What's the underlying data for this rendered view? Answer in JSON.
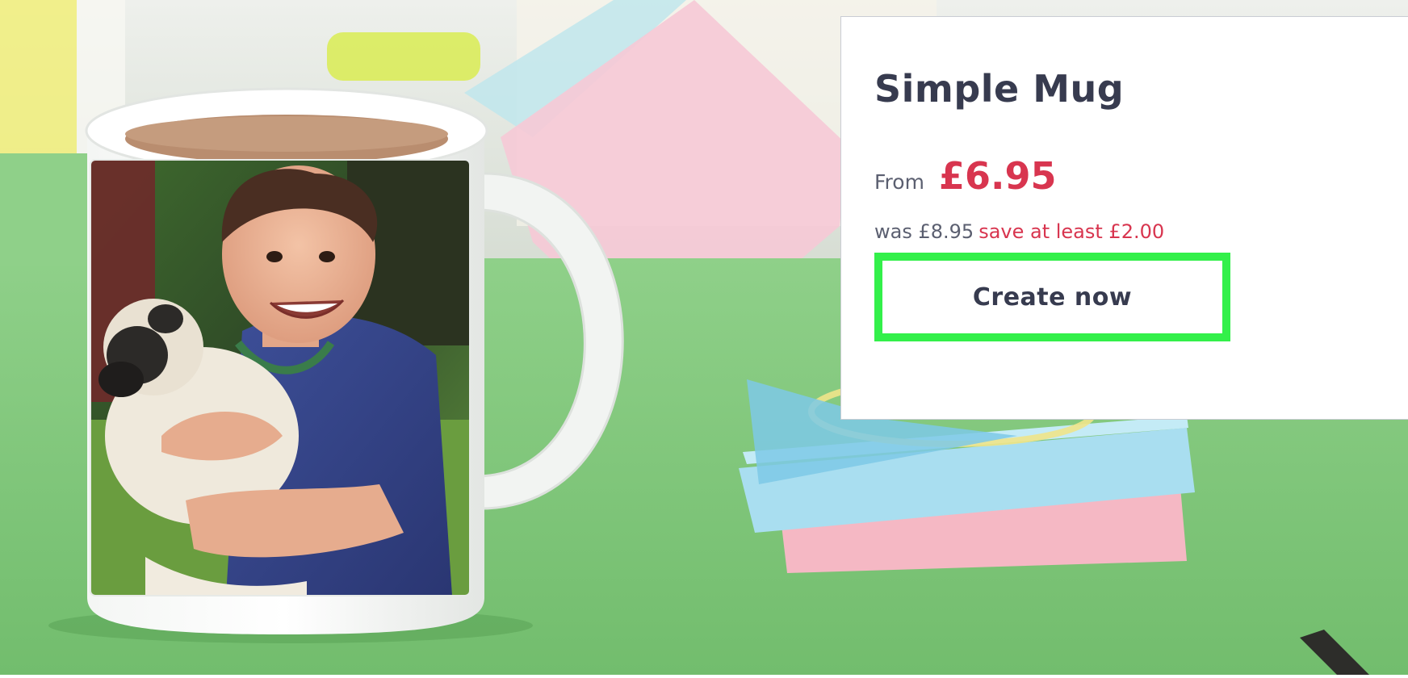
{
  "hero": {
    "image_subject": "photo mug with child holding a pug"
  },
  "product": {
    "title": "Simple Mug",
    "price_prefix": "From",
    "price": "£6.95",
    "was_text": "was £8.95",
    "save_text": "save at least £2.00",
    "cta_label": "Create now"
  },
  "colors": {
    "title": "#373b4f",
    "price": "#d8354f",
    "muted_text": "#5b5f70",
    "cta_highlight_border": "#33f04a"
  }
}
